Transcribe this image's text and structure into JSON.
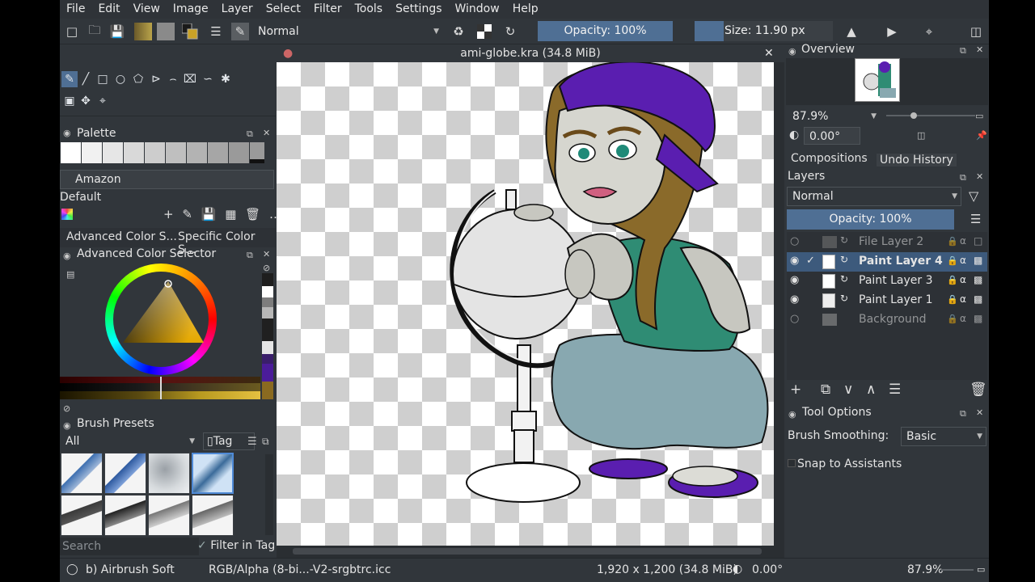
{
  "menu": [
    "File",
    "Edit",
    "View",
    "Image",
    "Layer",
    "Select",
    "Filter",
    "Tools",
    "Settings",
    "Window",
    "Help"
  ],
  "toolbar": {
    "blend_mode": "Normal",
    "opacity": "Opacity: 100%",
    "size": "Size: 11.90 px"
  },
  "document": {
    "title": "ami-globe.kra (34.8 MiB)"
  },
  "palette": {
    "title": "Palette",
    "name": "Amazon",
    "preset": "Default",
    "swatches": [
      "#ffffff",
      "#f1f1f1",
      "#e6e6e6",
      "#d9d9d9",
      "#cdcdcd",
      "#bfbfbf",
      "#b3b3b3",
      "#a6a6a6",
      "#9a9a9a",
      "#1a1a1a"
    ]
  },
  "color_tabs": [
    "Advanced Color S...",
    "Specific Color S..."
  ],
  "advanced_color_selector": {
    "title": "Advanced Color Selector"
  },
  "color_history": [
    "#ffffff",
    "#7d7d7d",
    "#b7b7b7",
    "#202020",
    "#3b3b3b",
    "#e5e5e5",
    "#3a1e6b",
    "#6a3fb0",
    "#c4a23a"
  ],
  "brush_presets": {
    "title": "Brush Presets",
    "filter": "All",
    "tag": "Tag",
    "search_placeholder": "Search",
    "filter_in_tag": "Filter in Tag"
  },
  "overview": {
    "title": "Overview",
    "zoom": "87.9%",
    "rotation": "0.00°"
  },
  "right_tabs": [
    "Compositions",
    "Undo History"
  ],
  "layers": {
    "title": "Layers",
    "blend": "Normal",
    "opacity": "Opacity:  100%",
    "items": [
      {
        "name": "File Layer 2",
        "visible": false,
        "active": false,
        "dim": true
      },
      {
        "name": "Paint Layer 4",
        "visible": true,
        "active": true,
        "dim": false
      },
      {
        "name": "Paint Layer 3",
        "visible": true,
        "active": false,
        "dim": false
      },
      {
        "name": "Paint Layer 1",
        "visible": true,
        "active": false,
        "dim": false
      },
      {
        "name": "Background",
        "visible": false,
        "active": false,
        "dim": true
      }
    ]
  },
  "tool_options": {
    "title": "Tool Options",
    "smoothing_label": "Brush Smoothing:",
    "smoothing_value": "Basic",
    "snap": "Snap to Assistants"
  },
  "status": {
    "brush": "b) Airbrush Soft",
    "color_space": "RGB/Alpha (8-bi...-V2-srgbtrc.icc",
    "dimensions": "1,920 x 1,200 (34.8 MiB)",
    "rotation": "0.00°",
    "zoom": "87.9%"
  }
}
